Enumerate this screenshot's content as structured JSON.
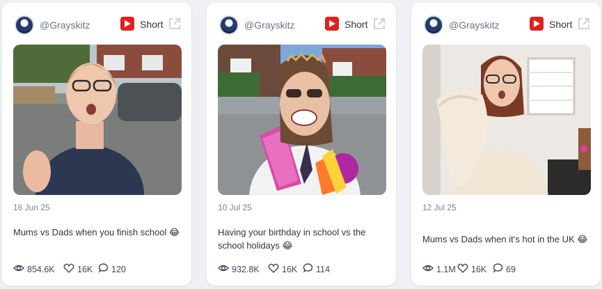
{
  "cards": [
    {
      "handle": "@Grayskitz",
      "platform_label": "Short",
      "date": "16 Jun 25",
      "caption": "Mums vs Dads when you finish school 😂",
      "views": "854.6K",
      "likes": "16K",
      "comments": "120",
      "thumbnail": "woman waving in street with parked car"
    },
    {
      "handle": "@Grayskitz",
      "platform_label": "Short",
      "date": "10 Jul 25",
      "caption": "Having your birthday in school vs the school holidays 😂",
      "views": "932.8K",
      "likes": "16K",
      "comments": "114",
      "thumbnail": "girl in school uniform with birthday sash and balloons"
    },
    {
      "handle": "@Grayskitz",
      "platform_label": "Short",
      "date": "12 Jul 25",
      "caption": "Mums vs Dads when it’s hot in the UK 😂",
      "views": "1.1M",
      "likes": "16K",
      "comments": "69",
      "thumbnail": "woman holding blanket in bright room"
    }
  ],
  "icons": {
    "platform": "youtube-icon",
    "external": "external-link-icon",
    "views": "eye-icon",
    "likes": "heart-icon",
    "comments": "comment-icon"
  },
  "colors": {
    "youtube_red": "#e02020",
    "background": "#eef0f4"
  }
}
